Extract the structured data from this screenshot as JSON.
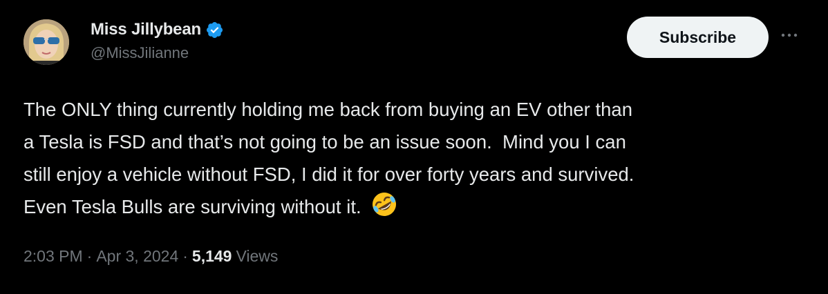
{
  "author": {
    "display_name": "Miss Jillybean",
    "handle": "@MissJilianne",
    "verified": true
  },
  "actions": {
    "subscribe_label": "Subscribe",
    "more_icon": "more-horizontal-icon"
  },
  "tweet": {
    "text": "The ONLY thing currently holding me back from buying an EV other than\na Tesla is FSD and that’s not going to be an issue soon.  Mind you I can\nstill enjoy a vehicle without FSD, I did it for over forty years and survived.\nEven Tesla Bulls are surviving without it. ",
    "emoji": "rolling-on-the-floor-laughing-emoji"
  },
  "meta": {
    "time": "2:03 PM",
    "separator": "·",
    "date": "Apr 3, 2024",
    "views_count": "5,149",
    "views_label": "Views"
  },
  "colors": {
    "background": "#000000",
    "text_primary": "#e7e9ea",
    "text_secondary": "#71767b",
    "verified_blue": "#1d9bf0",
    "button_bg": "#eff3f4"
  }
}
